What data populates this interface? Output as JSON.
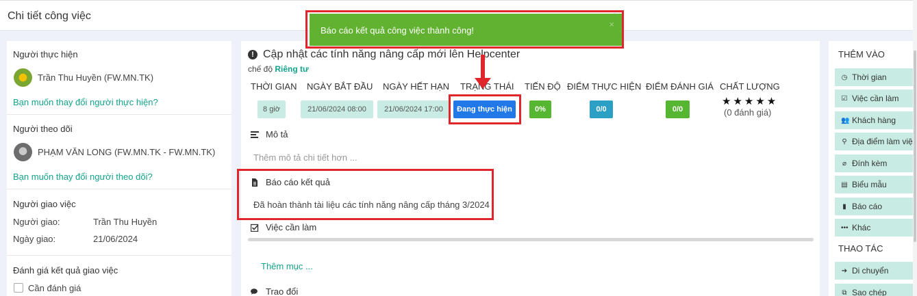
{
  "header": {
    "title": "Chi tiết công việc"
  },
  "left": {
    "assignee": {
      "label": "Người thực hiện",
      "name": "Trần Thu Huyền (FW.MN.TK)",
      "change_link": "Bạn muốn thay đổi người thực hiện?"
    },
    "follower": {
      "label": "Người theo dõi",
      "name": "PHẠM VĂN LONG (FW.MN.TK - FW.MN.TK)",
      "change_link": "Bạn muốn thay đổi người theo dõi?"
    },
    "assigner": {
      "label": "Người giao việc",
      "giver_label": "Người giao:",
      "giver_value": "Trần Thu Huyền",
      "date_label": "Ngày giao:",
      "date_value": "21/06/2024"
    },
    "evaluation": {
      "label": "Đánh giá kết quả giao việc",
      "checkbox_label": "Cần đánh giá"
    }
  },
  "task": {
    "title": "Cập nhật các tính năng nâng cấp mới lên Helpcenter",
    "mode_prefix": "chế độ",
    "mode_value": "Riêng tư",
    "columns": {
      "time": "THỜI GIAN",
      "start": "NGÀY BẮT ĐẦU",
      "end": "NGÀY HẾT HẠN",
      "status": "TRẠNG THÁI",
      "progress": "TIẾN ĐỘ",
      "score": "ĐIỂM THỰC HIỆN",
      "rating": "ĐIỂM ĐÁNH GIÁ",
      "quality": "CHẤT LƯỢNG"
    },
    "values": {
      "time": "8 giờ",
      "start": "21/06/2024 08:00",
      "end": "21/06/2024 17:00",
      "status": "Đang thực hiện",
      "progress": "0%",
      "score": "0/0",
      "rating": "0/0",
      "stars": "★★★★★",
      "rating_count": "(0 đánh giá)"
    },
    "description": {
      "label": "Mô tả",
      "placeholder": "Thêm mô tả chi tiết hơn ..."
    },
    "report": {
      "label": "Báo cáo kết quả",
      "text": "Đã hoàn thành tài liệu các tính năng nâng cấp tháng 3/2024"
    },
    "todo": {
      "label": "Việc cần làm",
      "progress_percent": 0,
      "add_label": "Thêm mục ..."
    },
    "discussion": {
      "label": "Trao đổi"
    }
  },
  "sidebar": {
    "add_title": "THÊM VÀO",
    "add_items": [
      "Thời gian",
      "Việc cần làm",
      "Khách hàng",
      "Địa điểm làm việc",
      "Đính kèm",
      "Biểu mẫu",
      "Báo cáo",
      "Khác"
    ],
    "actions_title": "THAO TÁC",
    "action_items": [
      "Di chuyển",
      "Sao chép"
    ]
  },
  "toast": {
    "message": "Báo cáo kết quả công việc thành công!",
    "close": "×"
  },
  "colors": {
    "accent": "#14a38b",
    "annotation": "#e0262b",
    "toast": "#62b232",
    "status": "#2179e8"
  }
}
